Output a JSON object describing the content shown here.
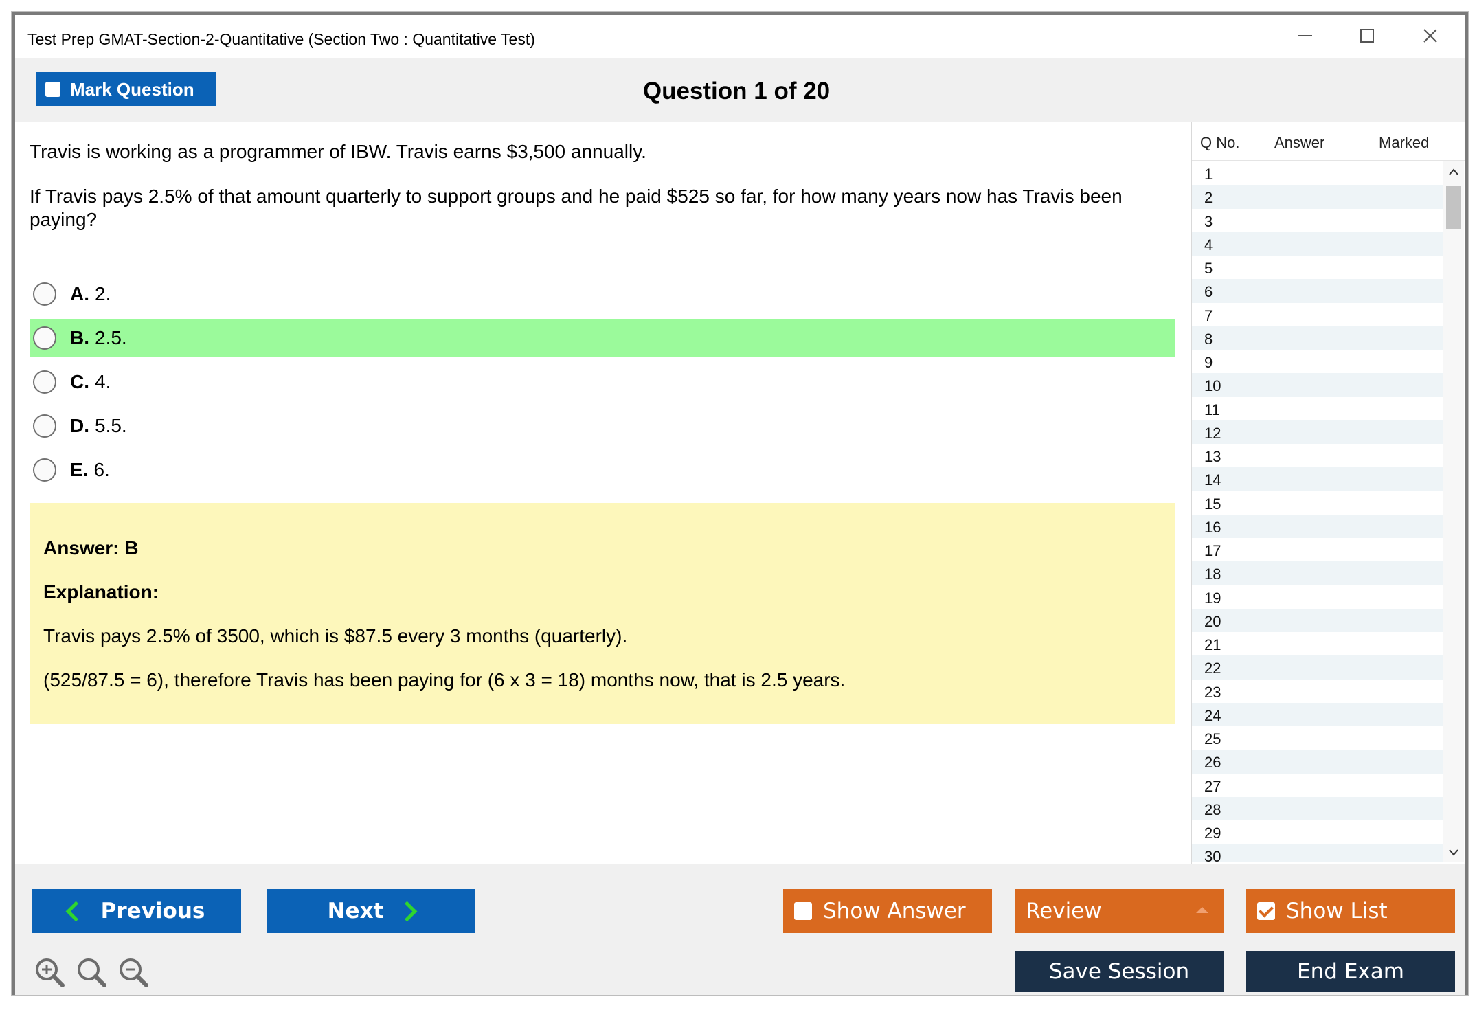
{
  "window": {
    "title": "Test Prep GMAT-Section-2-Quantitative (Section Two : Quantitative Test)"
  },
  "header": {
    "mark_label": "Mark Question",
    "question_counter": "Question 1 of 20"
  },
  "question": {
    "line1": "Travis is working as a programmer of IBW. Travis earns $3,500 annually.",
    "line2": "If Travis pays 2.5% of that amount quarterly to support groups and he paid $525 so far, for how many years now has Travis been paying?",
    "options": [
      {
        "letter": "A.",
        "text": " 2."
      },
      {
        "letter": "B.",
        "text": " 2.5."
      },
      {
        "letter": "C.",
        "text": " 4."
      },
      {
        "letter": "D.",
        "text": " 5.5."
      },
      {
        "letter": "E.",
        "text": " 6."
      }
    ],
    "highlighted_option": "B"
  },
  "answer": {
    "answer_line": "Answer: B",
    "explanation_label": "Explanation:",
    "explanation_1": "Travis pays 2.5% of 3500, which is $87.5 every 3 months (quarterly).",
    "explanation_2": "(525/87.5 = 6), therefore Travis has been paying for (6 x 3 = 18) months now, that is 2.5 years."
  },
  "question_list": {
    "columns": [
      "Q No.",
      "Answer",
      "Marked"
    ],
    "rows": [
      "1",
      "2",
      "3",
      "4",
      "5",
      "6",
      "7",
      "8",
      "9",
      "10",
      "11",
      "12",
      "13",
      "14",
      "15",
      "16",
      "17",
      "18",
      "19",
      "20",
      "21",
      "22",
      "23",
      "24",
      "25",
      "26",
      "27",
      "28",
      "29",
      "30"
    ]
  },
  "footer": {
    "previous_label": "Previous",
    "next_label": "Next",
    "show_answer_label": "Show Answer",
    "review_label": "Review",
    "show_list_label": "Show List",
    "save_session_label": "Save Session",
    "end_exam_label": "End Exam"
  },
  "colors": {
    "accent_blue": "#0b62b6",
    "accent_orange": "#d9691f",
    "dark_button": "#1b3048",
    "correct_highlight": "#9bfa9b",
    "answer_box": "#fdf7bb"
  }
}
